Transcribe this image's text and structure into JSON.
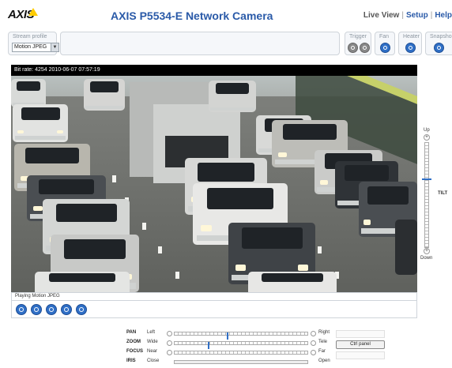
{
  "header": {
    "logo_text": "AXIS",
    "title": "AXIS P5534-E Network Camera",
    "nav": {
      "live_view": "Live View",
      "setup": "Setup",
      "help": "Help"
    }
  },
  "toolbar": {
    "stream_profile_label": "Stream profile",
    "stream_profile_value": "Motion JPEG",
    "trigger_label": "Trigger",
    "fan_label": "Fan",
    "heater_label": "Heater",
    "snapshot_label": "Snapsho"
  },
  "video": {
    "overlay_text": "Bit rate:  4254 2010-06-07 07:57:19",
    "status_text": "Playing Motion JPEG"
  },
  "tilt": {
    "label": "TILT",
    "up": "Up",
    "down": "Down",
    "level": 0.35
  },
  "ptz": {
    "pan": {
      "name": "PAN",
      "min": "Left",
      "max": "Right",
      "level": 0.4
    },
    "zoom": {
      "name": "ZOOM",
      "min": "Wide",
      "max": "Tele",
      "level": 0.25
    },
    "focus": {
      "name": "FOCUS",
      "min": "Near",
      "max": "Far",
      "level": 0.0
    },
    "iris": {
      "name": "IRIS",
      "min": "Close",
      "max": "Open",
      "level": 0.0
    }
  },
  "ctrl_panel_label": "Ctrl panel",
  "colors": {
    "brand_blue": "#2a5aa8",
    "button_blue": "#2f6fc6",
    "logo_yellow": "#ffcc00"
  }
}
